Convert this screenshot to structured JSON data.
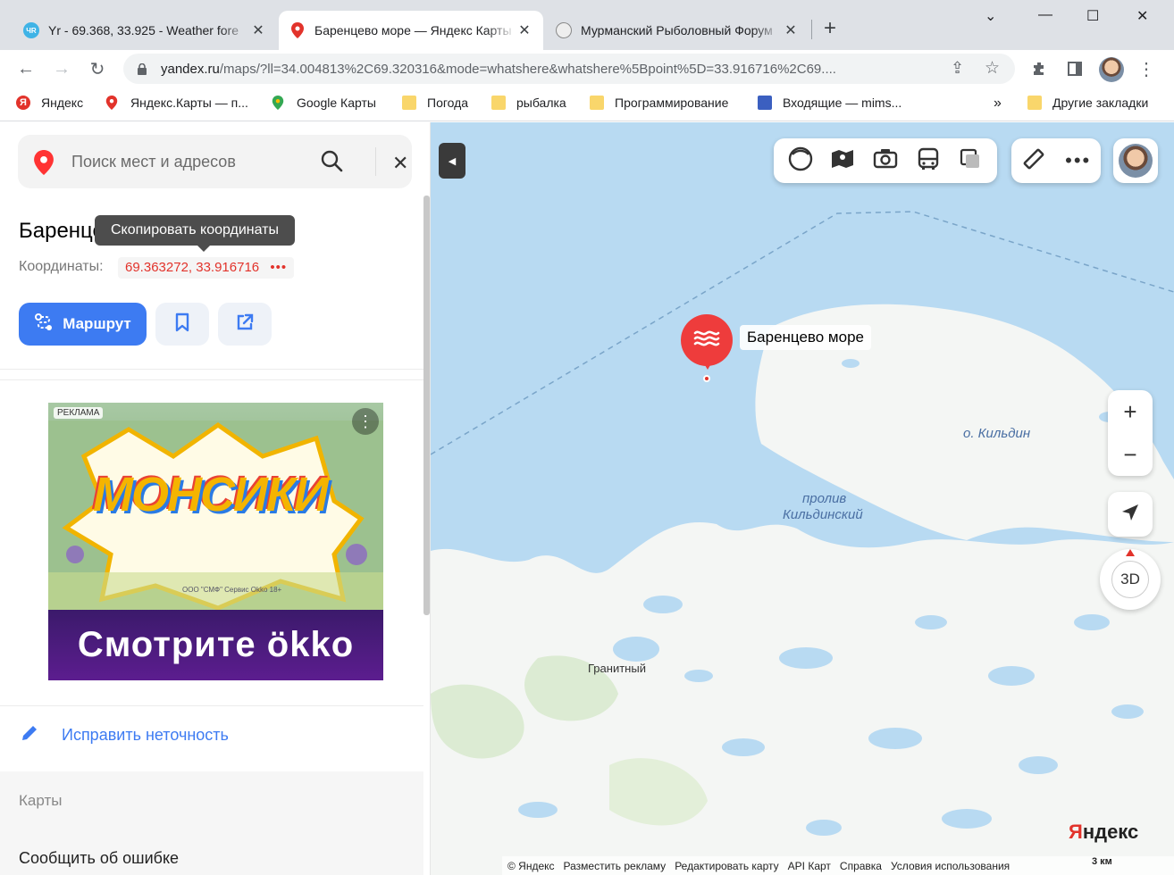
{
  "browser": {
    "tabs": [
      {
        "title": "Yr - 69.368, 33.925 - Weather fore",
        "favicon": "ЧR",
        "active": false
      },
      {
        "title": "Баренцево море — Яндекс Карты",
        "active": true
      },
      {
        "title": "Мурманский Рыболовный Форум",
        "active": false
      }
    ],
    "url_host": "yandex.ru",
    "url_path": "/maps/?ll=34.004813%2C69.320316&mode=whatshere&whatshere%5Bpoint%5D=33.916716%2C69....",
    "bookmarks": [
      {
        "label": "Яндекс"
      },
      {
        "label": "Яндекс.Карты — п..."
      },
      {
        "label": "Google Карты"
      },
      {
        "label": "Погода"
      },
      {
        "label": "рыбалка"
      },
      {
        "label": "Программирование"
      },
      {
        "label": "Входящие — mims..."
      }
    ],
    "more_bookmarks": "»",
    "other_bookmarks": "Другие закладки"
  },
  "sidebar": {
    "search_placeholder": "Поиск мест и адресов",
    "title": "Баренцево море",
    "tooltip": "Скопировать координаты",
    "coords_label": "Координаты:",
    "coords_value": "69.363272, 33.916716",
    "coords_more": "•••",
    "route_label": "Маршрут",
    "ad": {
      "label": "РЕКЛАМА",
      "brand": "МОНСИКИ",
      "fine_print": "ООО \"СМФ\" Сервис Okko 18+",
      "cta": "Смотрите ökko"
    },
    "fix_label": "Исправить неточность",
    "maps_label": "Карты",
    "report_label": "Сообщить об ошибке"
  },
  "map": {
    "poi_label": "Баренцево море",
    "island_label": "о. Кильдин",
    "strait_label_1": "пролив",
    "strait_label_2": "Кильдинский",
    "town_label": "Гранитный",
    "logo": "Яндекс",
    "compass_label": "3D",
    "scale_label": "3 км",
    "footer_links": [
      "© Яндекс",
      "Разместить рекламу",
      "Редактировать карту",
      "API Карт",
      "Справка",
      "Условия использования"
    ]
  },
  "colors": {
    "accent": "#3d7bf2",
    "brand_red": "#e2332b",
    "water": "#b8daf2",
    "land": "#f4f6f4"
  }
}
